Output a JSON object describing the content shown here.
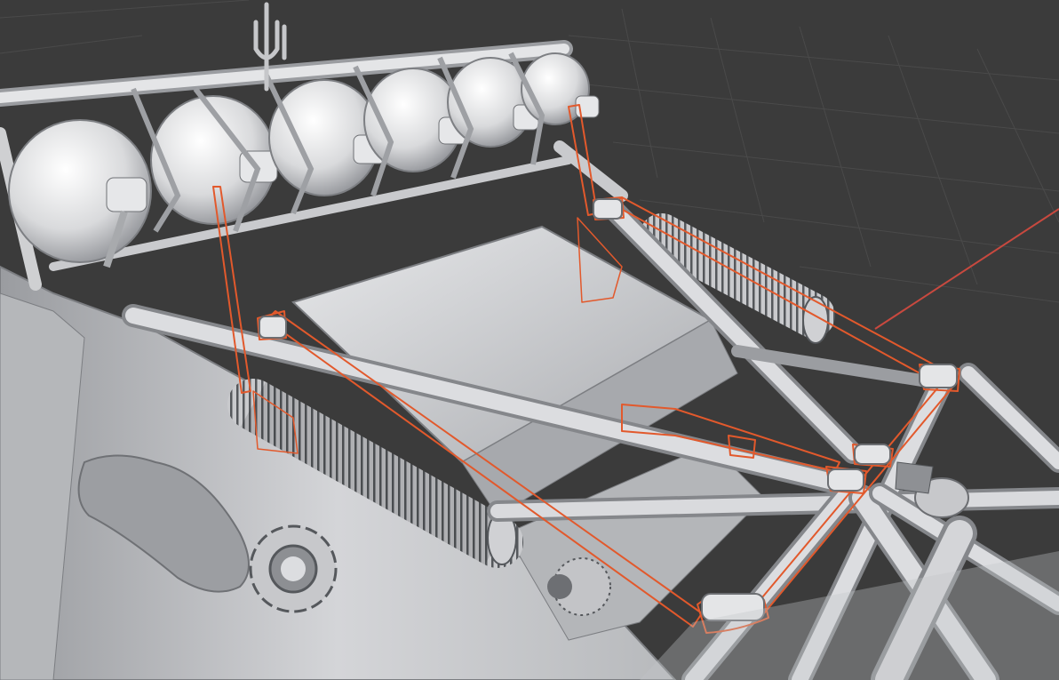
{
  "viewport": {
    "background": "#3b3b3b",
    "grid_color": "#4a4a4a",
    "x_axis_color": "#c8493f",
    "model_color": "#cfd0d2",
    "model_shadow": "#8e9094",
    "model_highlight": "#f2f3f5",
    "selection_outline_color": "#e2592c",
    "selected_object": "rear-suspension-linkage"
  }
}
